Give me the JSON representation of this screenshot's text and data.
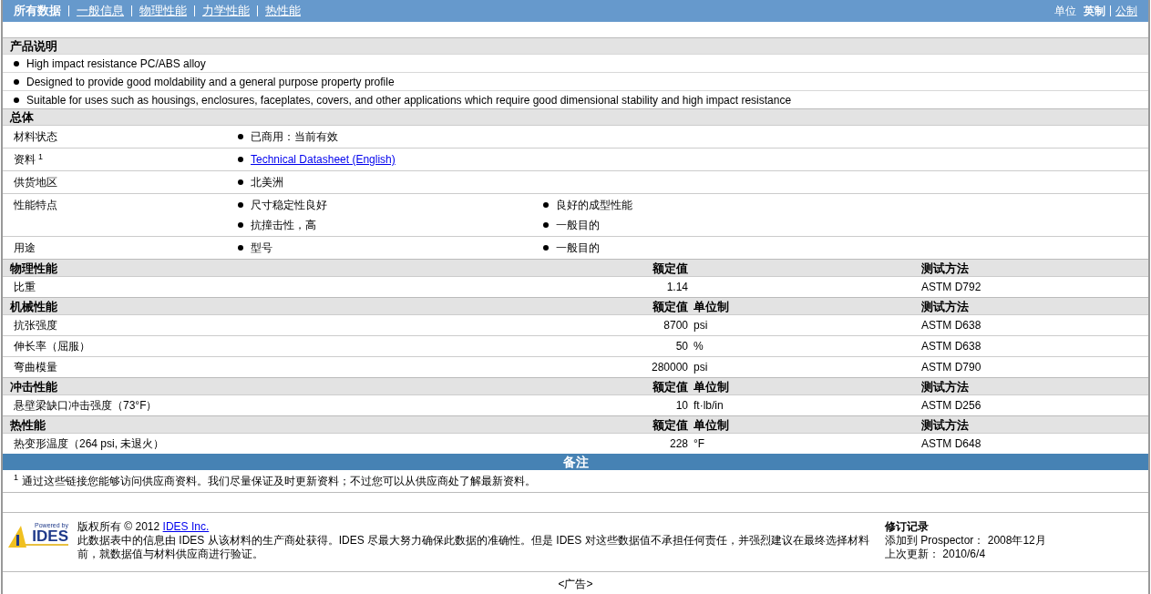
{
  "nav": {
    "items": [
      {
        "label": "所有数据",
        "selected": true
      },
      {
        "label": "一般信息",
        "selected": false
      },
      {
        "label": "物理性能",
        "selected": false
      },
      {
        "label": "力学性能",
        "selected": false
      },
      {
        "label": "热性能",
        "selected": false
      }
    ],
    "units_label": "单位",
    "units": [
      {
        "label": "英制",
        "selected": true
      },
      {
        "label": "公制",
        "selected": false
      }
    ]
  },
  "product_description": {
    "title": "产品说明",
    "bullets": [
      "High impact resistance PC/ABS alloy",
      "Designed to provide good moldability and a general purpose property profile",
      "Suitable for uses such as housings, enclosures, faceplates, covers, and other applications which require good dimensional stability and high impact resistance"
    ]
  },
  "general": {
    "title": "总体",
    "rows": [
      {
        "label": "材料状态",
        "values": [
          {
            "kind": "text",
            "text": "已商用：当前有效"
          }
        ]
      },
      {
        "label": "资料",
        "footnote": "1",
        "values": [
          {
            "kind": "link",
            "text": "Technical Datasheet (English)"
          }
        ]
      },
      {
        "label": "供货地区",
        "values": [
          {
            "kind": "text",
            "text": "北美洲"
          }
        ]
      },
      {
        "label": "性能特点",
        "values": [
          {
            "kind": "text",
            "text": "尺寸稳定性良好"
          },
          {
            "kind": "text",
            "text": "良好的成型性能"
          },
          {
            "kind": "text",
            "text": "抗撞击性，高"
          },
          {
            "kind": "text",
            "text": "一般目的"
          }
        ]
      },
      {
        "label": "用途",
        "values": [
          {
            "kind": "text",
            "text": "型号"
          },
          {
            "kind": "text",
            "text": "一般目的"
          }
        ]
      }
    ]
  },
  "property_sections": [
    {
      "title": "物理性能",
      "value_header": "额定值",
      "test_header": "测试方法",
      "rows": [
        {
          "name": "比重",
          "value": "1.14",
          "test": "ASTM D792"
        }
      ]
    },
    {
      "title": "机械性能",
      "value_header": "额定值",
      "unit_header": "单位制",
      "test_header": "测试方法",
      "rows": [
        {
          "name": "抗张强度",
          "value": "8700",
          "unit": "psi",
          "test": "ASTM D638"
        },
        {
          "name": "伸长率（屈服）",
          "value": "50",
          "unit": "%",
          "test": "ASTM D638"
        },
        {
          "name": "弯曲模量",
          "value": "280000",
          "unit": "psi",
          "test": "ASTM D790"
        }
      ]
    },
    {
      "title": "冲击性能",
      "value_header": "额定值",
      "unit_header": "单位制",
      "test_header": "测试方法",
      "rows": [
        {
          "name": "悬壁梁缺口冲击强度（73°F）",
          "value": "10",
          "unit": "ft·lb/in",
          "test": "ASTM D256"
        }
      ]
    },
    {
      "title": "热性能",
      "value_header": "额定值",
      "unit_header": "单位制",
      "test_header": "测试方法",
      "rows": [
        {
          "name": "热变形温度（264 psi, 未退火）",
          "value": "228",
          "unit": "°F",
          "test": "ASTM D648"
        }
      ]
    }
  ],
  "notes": {
    "title": "备注",
    "footnotes": [
      {
        "mark": "1",
        "text": "通过这些链接您能够访问供应商资料。我们尽量保证及时更新资料；不过您可以从供应商处了解最新资料。"
      }
    ]
  },
  "footer": {
    "logo": {
      "tagline": "Powered by",
      "name": "IDES"
    },
    "copyright_label": "版权所有",
    "copyright": "© 2012",
    "company_link": "IDES Inc.",
    "disclaimer": "此数据表中的信息由 IDES 从该材料的生产商处获得。IDES 尽最大努力确保此数据的准确性。但是 IDES 对这些数据值不承担任何责任，并强烈建议在最终选择材料前，就数据值与材料供应商进行验证。",
    "revision": {
      "title": "修订记录",
      "added_label": "添加到",
      "added_product": "Prospector：",
      "added_date": "2008年12月",
      "updated_label": "上次更新：",
      "updated_date": "2010/6/4"
    }
  },
  "ad": "<广告>"
}
